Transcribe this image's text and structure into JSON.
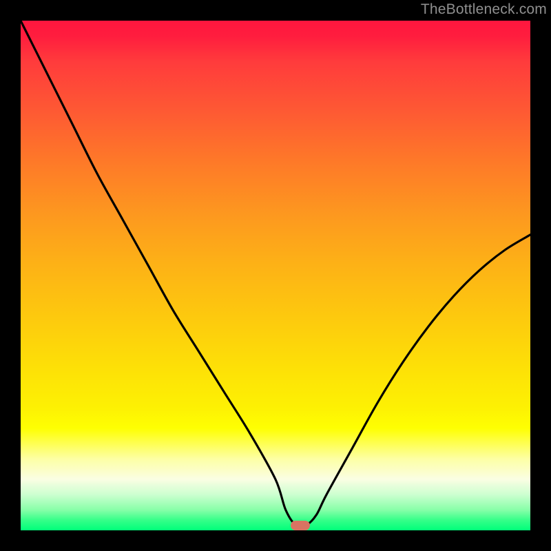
{
  "watermark": "TheBottleneck.com",
  "marker": {
    "cx_frac": 0.548,
    "cy_frac": 0.991
  },
  "chart_data": {
    "type": "line",
    "title": "",
    "xlabel": "",
    "ylabel": "",
    "xlim": [
      0,
      1
    ],
    "ylim": [
      0,
      1
    ],
    "series": [
      {
        "name": "bottleneck-curve",
        "x": [
          0.0,
          0.05,
          0.1,
          0.15,
          0.2,
          0.25,
          0.3,
          0.35,
          0.4,
          0.45,
          0.5,
          0.52,
          0.54,
          0.56,
          0.58,
          0.6,
          0.65,
          0.7,
          0.75,
          0.8,
          0.85,
          0.9,
          0.95,
          1.0
        ],
        "y": [
          1.0,
          0.9,
          0.8,
          0.7,
          0.61,
          0.52,
          0.43,
          0.35,
          0.27,
          0.19,
          0.1,
          0.04,
          0.01,
          0.01,
          0.03,
          0.07,
          0.16,
          0.25,
          0.33,
          0.4,
          0.46,
          0.51,
          0.55,
          0.58
        ]
      }
    ],
    "marker": {
      "x": 0.548,
      "y": 0.009
    },
    "gradient_stops": [
      {
        "pos": 0.0,
        "color": "#ff163e"
      },
      {
        "pos": 0.8,
        "color": "#feff02"
      },
      {
        "pos": 1.0,
        "color": "#00ff7a"
      }
    ]
  }
}
